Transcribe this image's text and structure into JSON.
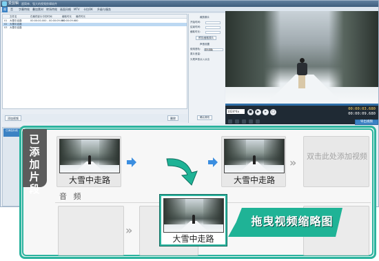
{
  "app": {
    "title": "爱剪辑",
    "subtitle": "超简单、强大的视频剪辑软件"
  },
  "menu": {
    "items": [
      "视",
      "音",
      "字幕特效",
      "叠加素材",
      "转场特效",
      "画面风格",
      "MTV",
      "卡拉OK",
      "升级与服务"
    ]
  },
  "clip_list": {
    "columns": [
      "",
      "文件名",
      "在最终影片中的时间",
      "截取时长",
      "最终时长"
    ],
    "rows": [
      [
        "01",
        "大雪中走路",
        "00:00:00.000 - 00:00:09.680",
        "00:00:09.680",
        ""
      ],
      [
        "02",
        "大雪中走路",
        "",
        "",
        ""
      ],
      [
        "03",
        "大雪中走路",
        "",
        "",
        ""
      ]
    ],
    "add_button": "添加视频",
    "delete_button": "删除"
  },
  "properties": {
    "section_title": "裁剪原片",
    "start_label": "开始时间:",
    "end_label": "结束时间:",
    "duration_label": "截取时长:",
    "preview_button": "预览/截取原片",
    "audio_title": "声音设置",
    "mode_label": "使用音轨:",
    "mode_value": "原片音轨",
    "volume_label": "原片音量:",
    "checkbox_label": "头尾声音淡入淡出",
    "confirm_button": "确认修改"
  },
  "player": {
    "ratio": "1024*4x 720",
    "time_current": "00:00:03.680",
    "time_total": "00:00:09.680",
    "export_button": "导出视频"
  },
  "timeline_left": {
    "label": "已添加片段"
  },
  "overlay": {
    "clip_section_label": "已添加片段",
    "clips": [
      "大雪中走路",
      "大雪中走路"
    ],
    "placeholder": "双击此处添加视频",
    "audio_label": "音 频",
    "dragging_clip": "大雪中走路",
    "drag_hint": "拖曳视频缩略图"
  },
  "colors": {
    "accent": "#2bb39e",
    "banner": "#1fb396",
    "arrow_blue": "#3b8ee0",
    "title_bar": "#4a6a8a"
  }
}
